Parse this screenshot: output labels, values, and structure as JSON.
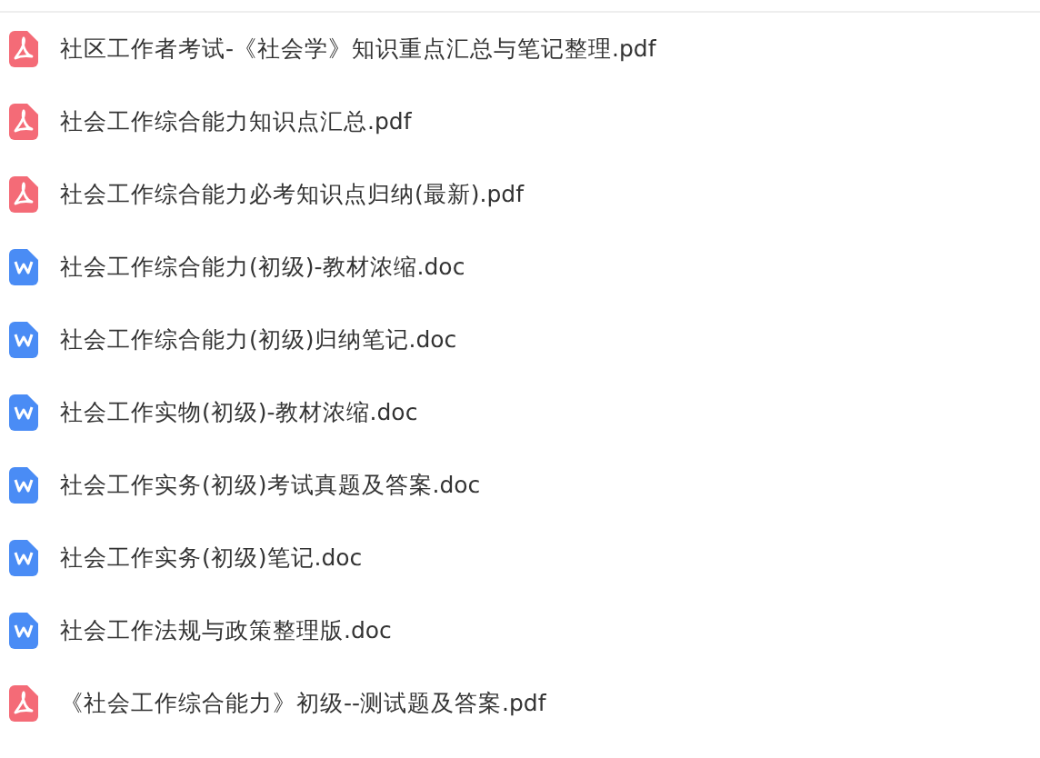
{
  "files": [
    {
      "kind": "pdf",
      "name": "社区工作者考试-《社会学》知识重点汇总与笔记整理.pdf"
    },
    {
      "kind": "pdf",
      "name": "社会工作综合能力知识点汇总.pdf"
    },
    {
      "kind": "pdf",
      "name": "社会工作综合能力必考知识点归纳(最新).pdf"
    },
    {
      "kind": "doc",
      "name": "社会工作综合能力(初级)-教材浓缩.doc"
    },
    {
      "kind": "doc",
      "name": "社会工作综合能力(初级)归纳笔记.doc"
    },
    {
      "kind": "doc",
      "name": "社会工作实物(初级)-教材浓缩.doc"
    },
    {
      "kind": "doc",
      "name": "社会工作实务(初级)考试真题及答案.doc"
    },
    {
      "kind": "doc",
      "name": "社会工作实务(初级)笔记.doc"
    },
    {
      "kind": "doc",
      "name": "社会工作法规与政策整理版.doc"
    },
    {
      "kind": "pdf",
      "name": "《社会工作综合能力》初级--测试题及答案.pdf"
    }
  ]
}
